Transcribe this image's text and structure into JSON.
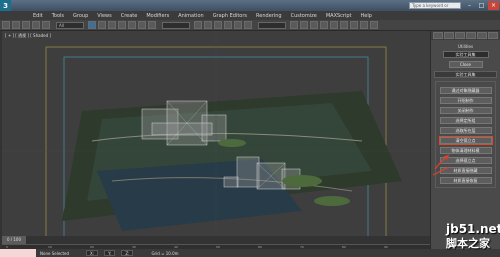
{
  "titlebar": {
    "search_placeholder": "Type a keyword or phrase"
  },
  "menubar": {
    "items": [
      "Edit",
      "Tools",
      "Group",
      "Views",
      "Create",
      "Modifiers",
      "Animation",
      "Graph Editors",
      "Rendering",
      "Customize",
      "MAXScript",
      "Help"
    ]
  },
  "toolbar": {
    "selection_filter": "All"
  },
  "viewport": {
    "label": "[ + ] [ 透视 ] [ Shaded ]"
  },
  "cmd_panel": {
    "utilities_label": "Utilities",
    "utility_dropdown": "实验工具集",
    "close_button": "Close",
    "rollout_title": "实验工具集",
    "buttons": [
      "通过对象隐藏器",
      "开阳制作",
      "关闭制作",
      "选择定所组",
      "选取所在层",
      "清空孤立点",
      "物体清理材料模",
      "选择孤立点",
      "材质直接隐藏",
      "材质直接恢复"
    ]
  },
  "timeline": {
    "slider_label": "0 / 100"
  },
  "ruler": {
    "ticks": [
      "0",
      "10",
      "20",
      "30",
      "40",
      "50",
      "60",
      "70",
      "80",
      "90"
    ]
  },
  "statusbar": {
    "selection": "None Selected",
    "grid": "Grid = 10.0m"
  },
  "watermark": {
    "domain": "jb51.net",
    "chinese": "脚本之家"
  }
}
